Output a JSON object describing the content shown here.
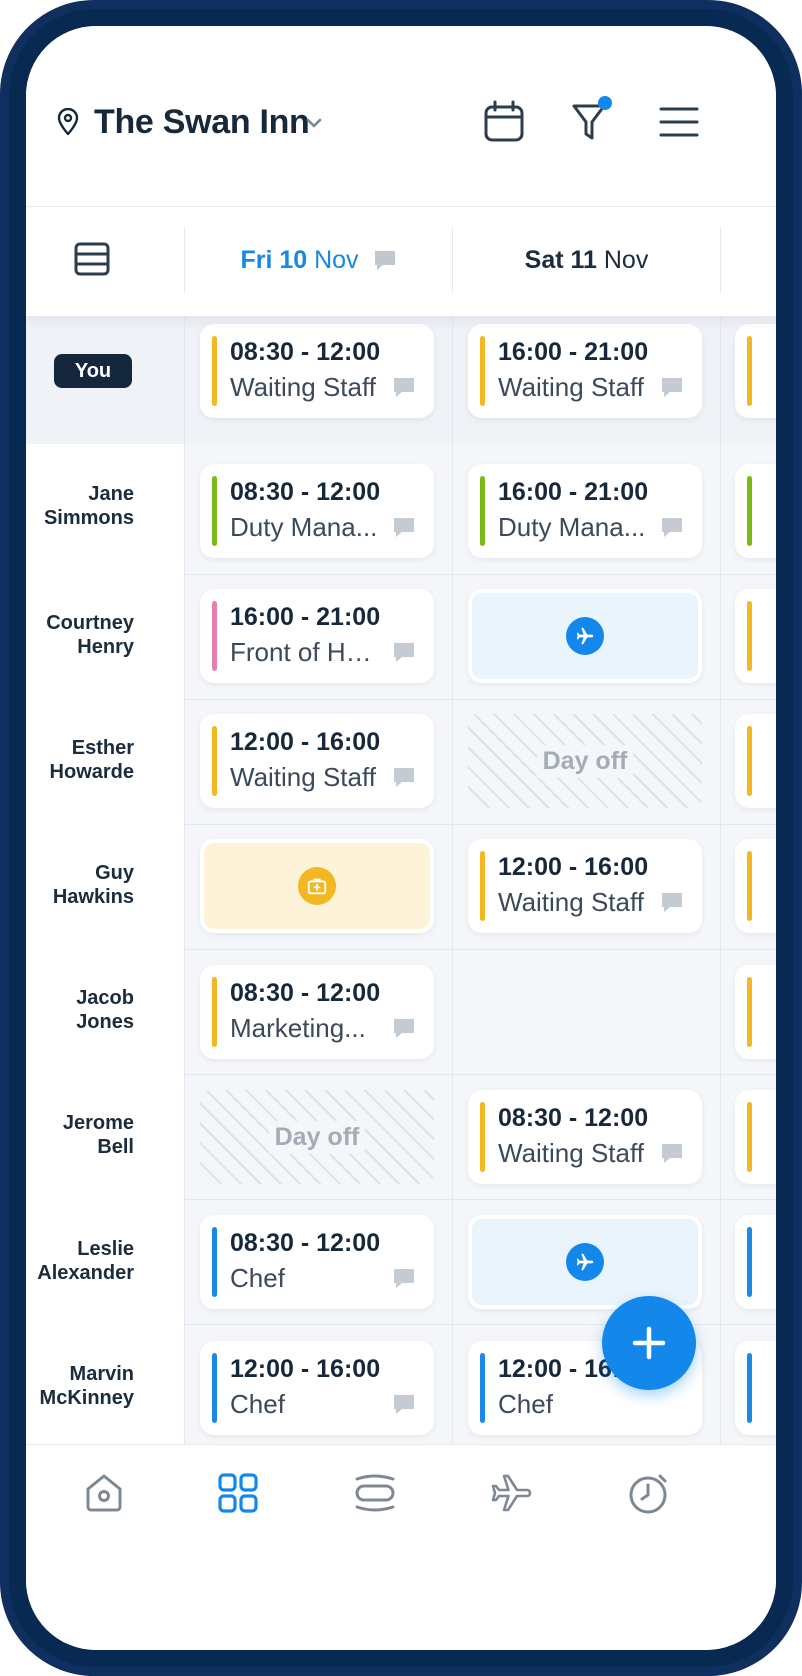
{
  "header": {
    "venue": "The Swan Inn"
  },
  "days": [
    {
      "label_bold": "Fri 10",
      "label_rest": "Nov"
    },
    {
      "label_bold": "Sat 11",
      "label_rest": "Nov"
    }
  ],
  "you_badge": "You",
  "employees": [
    {
      "first": "Jane",
      "last": "Simmons"
    },
    {
      "first": "Courtney",
      "last": "Henry"
    },
    {
      "first": "Esther",
      "last": "Howarde"
    },
    {
      "first": "Guy",
      "last": "Hawkins"
    },
    {
      "first": "Jacob",
      "last": "Jones"
    },
    {
      "first": "Jerome",
      "last": "Bell"
    },
    {
      "first": "Leslie",
      "last": "Alexander"
    },
    {
      "first": "Marvin",
      "last": "McKinney"
    }
  ],
  "shifts": {
    "you_fri": {
      "time": "08:30 - 12:00",
      "role": "Waiting Staff",
      "color": "#f2b722"
    },
    "you_sat": {
      "time": "16:00 - 21:00",
      "role": "Waiting Staff",
      "color": "#f2b722"
    },
    "jane_fri": {
      "time": "08:30 - 12:00",
      "role": "Duty Mana...",
      "color": "#7cbb17"
    },
    "jane_sat": {
      "time": "16:00 - 21:00",
      "role": "Duty Mana...",
      "color": "#7cbb17"
    },
    "courtney_fri": {
      "time": "16:00 - 21:00",
      "role": "Front of Ho...",
      "color": "#e57fb0"
    },
    "esther_fri": {
      "time": "12:00 - 16:00",
      "role": "Waiting Staff",
      "color": "#f2b722"
    },
    "guy_sat": {
      "time": "12:00 - 16:00",
      "role": "Waiting Staff",
      "color": "#f2b722"
    },
    "jacob_fri": {
      "time": "08:30 - 12:00",
      "role": "Marketing...",
      "color": "#f2b722"
    },
    "jerome_sat": {
      "time": "08:30 - 12:00",
      "role": "Waiting Staff",
      "color": "#f2b722"
    },
    "leslie_fri": {
      "time": "08:30 - 12:00",
      "role": "Chef",
      "color": "#1b8ae6"
    },
    "marvin_fri": {
      "time": "12:00 - 16:00",
      "role": "Chef",
      "color": "#1b8ae6"
    },
    "marvin_sat": {
      "time": "12:00 - 16:00",
      "role": "Chef",
      "color": "#1b8ae6"
    }
  },
  "day_off_label": "Day off",
  "icons": {
    "location": "map-pin-icon",
    "chevron": "chevron-down-icon",
    "calendar": "calendar-icon",
    "filter": "filter-icon",
    "menu": "hamburger-menu-icon",
    "list": "list-view-icon",
    "comment": "comment-icon",
    "holiday": "airplane-icon",
    "sick": "medical-kit-icon",
    "add": "plus-icon",
    "nav": [
      "home-icon",
      "grid-icon",
      "shifts-icon",
      "airplane-icon",
      "clock-icon"
    ]
  },
  "colors": {
    "accent": "#1488ea",
    "waiting_staff": "#f2b722",
    "duty_manager": "#7cbb17",
    "front_of_house": "#e57fb0",
    "chef": "#1b8ae6"
  }
}
